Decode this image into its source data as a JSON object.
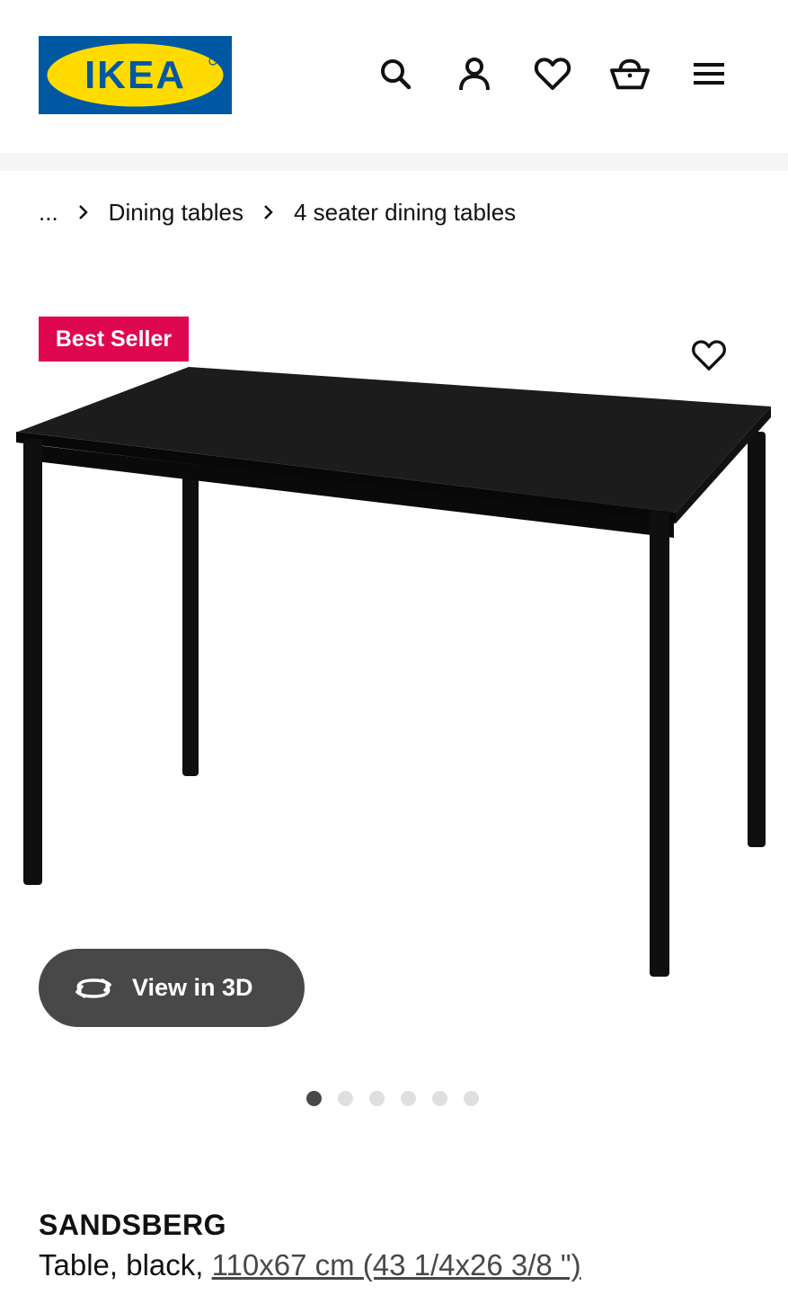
{
  "header": {
    "logo_text": "IKEA",
    "logo_colors": {
      "blue": "#0058a3",
      "yellow": "#ffdb00"
    },
    "icons": [
      "search-icon",
      "account-icon",
      "wishlist-heart-icon",
      "shopping-basket-icon",
      "menu-hamburger-icon"
    ]
  },
  "breadcrumb": {
    "ellipsis": "...",
    "items": [
      "Dining tables",
      "4 seater dining tables"
    ]
  },
  "product": {
    "badge": "Best Seller",
    "badge_color": "#e00751",
    "view_3d_label": "View in 3D",
    "gallery": {
      "image_count": 6,
      "active_index": 0
    },
    "name": "SANDSBERG",
    "description_prefix": "Table, black, ",
    "size_link": "110x67 cm (43 1/4x26 3/8 \")"
  }
}
